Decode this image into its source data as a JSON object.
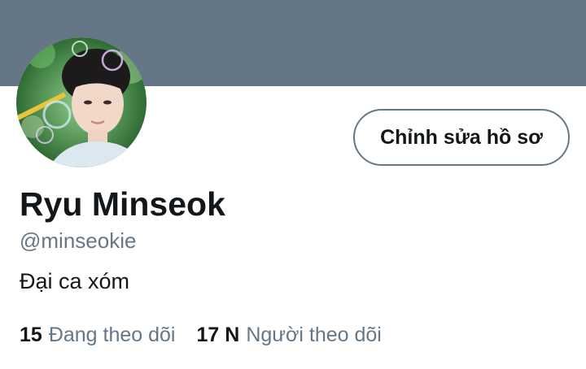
{
  "profile": {
    "display_name": "Ryu Minseok",
    "handle": "@minseokie",
    "bio": "Đại ca xóm",
    "edit_button_label": "Chỉnh sửa hồ sơ",
    "following_count": "15",
    "following_label": "Đang theo dõi",
    "followers_count": "17 N",
    "followers_label": "Người theo dõi"
  },
  "colors": {
    "banner": "#657786",
    "primary_text": "#14171a",
    "secondary_text": "#657786",
    "button_border": "#657786"
  }
}
